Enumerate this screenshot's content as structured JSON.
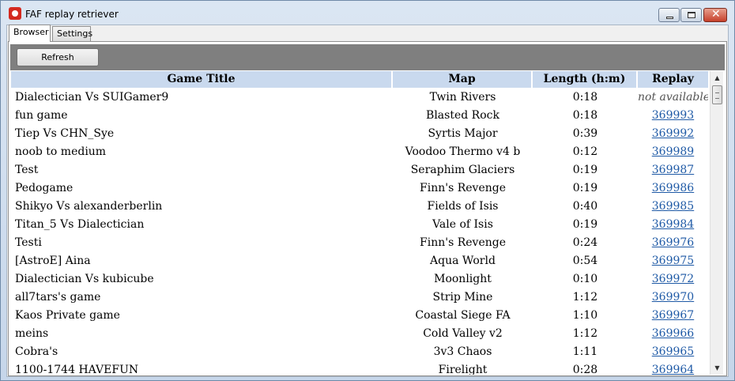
{
  "window": {
    "title": "FAF replay retriever",
    "close_glyph": "✕"
  },
  "tabs": [
    {
      "label": "Browser",
      "active": true
    },
    {
      "label": "Settings",
      "active": false
    }
  ],
  "toolbar": {
    "refresh_label": "Refresh"
  },
  "table": {
    "columns": [
      "Game Title",
      "Map",
      "Length (h:m)",
      "Replay"
    ],
    "rows": [
      {
        "title": "Dialectician Vs SUIGamer9",
        "map": "Twin Rivers",
        "length": "0:18",
        "replay": "not available"
      },
      {
        "title": "fun game",
        "map": "Blasted Rock",
        "length": "0:18",
        "replay": "369993"
      },
      {
        "title": "Tiep Vs CHN_Sye",
        "map": "Syrtis Major",
        "length": "0:39",
        "replay": "369992"
      },
      {
        "title": "noob to medium",
        "map": "Voodoo Thermo v4 b",
        "length": "0:12",
        "replay": "369989"
      },
      {
        "title": "Test",
        "map": "Seraphim Glaciers",
        "length": "0:19",
        "replay": "369987"
      },
      {
        "title": "Pedogame",
        "map": "Finn's Revenge",
        "length": "0:19",
        "replay": "369986"
      },
      {
        "title": "Shikyo Vs alexanderberlin",
        "map": "Fields of Isis",
        "length": "0:40",
        "replay": "369985"
      },
      {
        "title": "Titan_5 Vs Dialectician",
        "map": "Vale of Isis",
        "length": "0:19",
        "replay": "369984"
      },
      {
        "title": "Testi",
        "map": "Finn's Revenge",
        "length": "0:24",
        "replay": "369976"
      },
      {
        "title": "[AstroE] Aina",
        "map": "Aqua World",
        "length": "0:54",
        "replay": "369975"
      },
      {
        "title": "Dialectician Vs kubicube",
        "map": "Moonlight",
        "length": "0:10",
        "replay": "369972"
      },
      {
        "title": "all7tars's game",
        "map": "Strip Mine",
        "length": "1:12",
        "replay": "369970"
      },
      {
        "title": "Kaos Private game",
        "map": "Coastal Siege FA",
        "length": "1:10",
        "replay": "369967"
      },
      {
        "title": "meins",
        "map": "Cold Valley v2",
        "length": "1:12",
        "replay": "369966"
      },
      {
        "title": "Cobra's",
        "map": "3v3 Chaos",
        "length": "1:11",
        "replay": "369965"
      },
      {
        "title": "1100-1744 HAVEFUN",
        "map": "Firelight",
        "length": "0:28",
        "replay": "369964"
      }
    ]
  },
  "scrollbar": {
    "up_glyph": "▲",
    "down_glyph": "▼"
  }
}
